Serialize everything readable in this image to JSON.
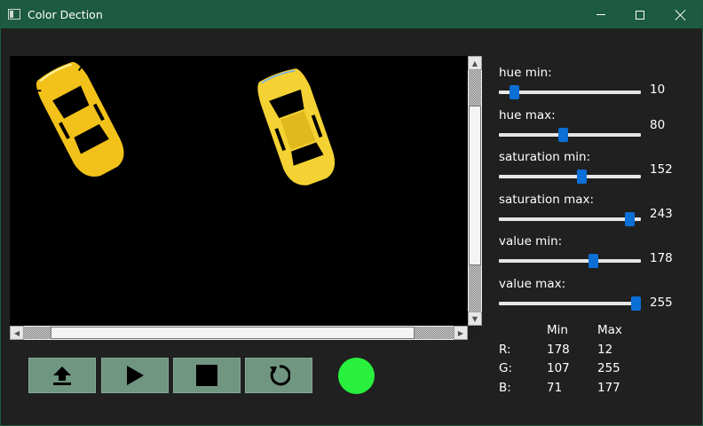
{
  "window": {
    "title": "Color Dection"
  },
  "toolbar": {
    "upload_icon": "upload-icon",
    "play_icon": "play-icon",
    "stop_icon": "stop-icon",
    "reset_icon": "reset-icon",
    "status_color": "#28f03c"
  },
  "sliders": [
    {
      "label": "hue min:",
      "value": "10",
      "fraction": 0.08
    },
    {
      "label": "hue max:",
      "value": "80",
      "fraction": 0.45
    },
    {
      "label": "saturation min:",
      "value": "152",
      "fraction": 0.59
    },
    {
      "label": "saturation max:",
      "value": "243",
      "fraction": 0.95
    },
    {
      "label": "value min:",
      "value": "178",
      "fraction": 0.68
    },
    {
      "label": "value max:",
      "value": "255",
      "fraction": 1.0
    }
  ],
  "rgb_table": {
    "headers": {
      "min": "Min",
      "max": "Max"
    },
    "rows": [
      {
        "label": "R:",
        "min": "178",
        "max": "12"
      },
      {
        "label": "G:",
        "min": "107",
        "max": "255"
      },
      {
        "label": "B:",
        "min": "71",
        "max": "177"
      }
    ]
  },
  "colors": {
    "accent": "#0b6fd6",
    "titlebar": "#1c5a42",
    "button": "#709581",
    "car": "#f2c21b"
  }
}
